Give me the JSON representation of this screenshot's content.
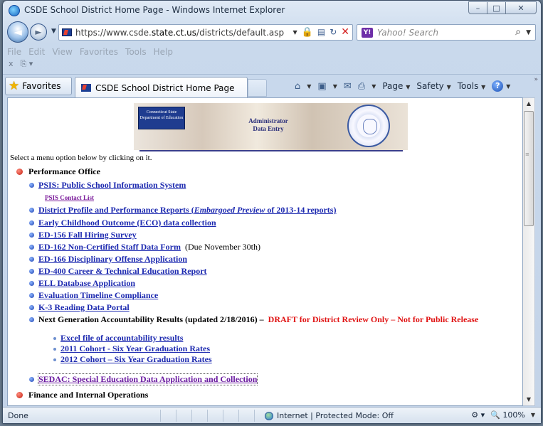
{
  "window": {
    "title": "CSDE School District Home Page - Windows Internet Explorer",
    "minimize": "–",
    "maximize": "□",
    "close": "✕"
  },
  "navbar": {
    "url_prefix": "https://www.csde.",
    "url_domain": "state.ct.us",
    "url_path": "/districts/default.asp",
    "search_engine_label": "Y!",
    "search_placeholder": "Yahoo! Search"
  },
  "menubar": {
    "items": [
      "File",
      "Edit",
      "View",
      "Favorites",
      "Tools",
      "Help"
    ]
  },
  "favbar": {
    "favorites_label": "Favorites",
    "tab_title": "CSDE School District Home Page",
    "cmd_page": "Page",
    "cmd_safety": "Safety",
    "cmd_tools": "Tools",
    "help_glyph": "?"
  },
  "page": {
    "banner_logo_text": "Connecticut State Department of Education",
    "banner_title_line1": "Administrator",
    "banner_title_line2": "Data Entry",
    "intro": "Select a menu option below by clicking on it.",
    "section1": "Performance Office",
    "links": {
      "psis": "PSIS: Public School Information System",
      "psis_contact": "PSIS Contact List",
      "district_profile_a": "District Profile and Performance Reports (",
      "district_profile_em": "Embargoed Preview",
      "district_profile_b": " of 2013-14 reports)",
      "eco": "Early Childhood Outcome (ECO) data collection",
      "ed156": "ED-156 Fall Hiring Survey",
      "ed162": "ED-162 Non-Certified Staff Data Form",
      "ed162_note": "(Due November 30th)",
      "ed166": "ED-166 Disciplinary Offense Application",
      "ed400": "ED-400 Career & Technical Education Report",
      "ell": "ELL Database Application",
      "eval": "Evaluation Timeline Compliance",
      "k3": "K-3 Reading Data Portal",
      "nextgen_text": "Next Generation Accountability Results (updated 2/18/2016) –",
      "nextgen_draft": "DRAFT for District Review Only – Not for Public Release",
      "excel": "Excel file of accountability results",
      "cohort2011": "2011 Cohort - Six Year Graduation Rates",
      "cohort2012": "2012 Cohort – Six Year Graduation Rates",
      "sedac": "SEDAC: Special Education Data Application and Collection"
    },
    "section2": "Finance and Internal Operations"
  },
  "status": {
    "done": "Done",
    "zone": "Internet | Protected Mode: Off",
    "zoom": "100%"
  }
}
